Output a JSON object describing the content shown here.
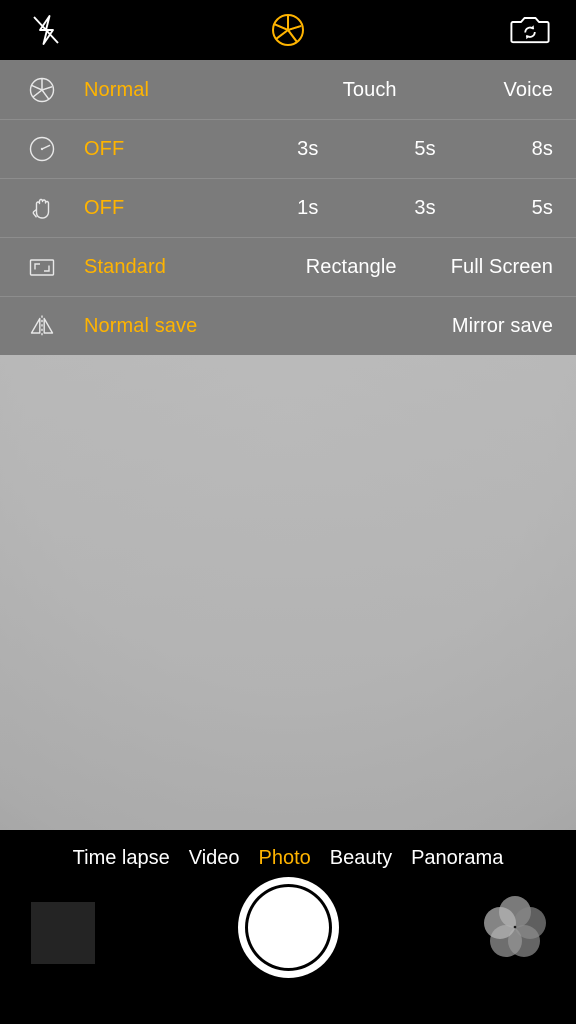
{
  "top_bar": {
    "flash_icon": "flash-off-icon",
    "flash_label": "Flash off",
    "shutter_mode_icon": "aperture-icon",
    "shutter_mode_label": "Aperture",
    "switch_camera_icon": "camera-switch-icon",
    "switch_camera_label": "Switch camera"
  },
  "settings": {
    "rows": [
      {
        "icon": "aperture-icon",
        "icon_label": "Capture mode",
        "options": [
          {
            "label": "Normal",
            "selected": true
          },
          {
            "label": "Touch",
            "selected": false
          },
          {
            "label": "Voice",
            "selected": false
          }
        ]
      },
      {
        "icon": "timer-icon",
        "icon_label": "Timer",
        "options": [
          {
            "label": "OFF",
            "selected": true
          },
          {
            "label": "3s",
            "selected": false
          },
          {
            "label": "5s",
            "selected": false
          },
          {
            "label": "8s",
            "selected": false
          }
        ]
      },
      {
        "icon": "hand-gesture-icon",
        "icon_label": "Gesture shot",
        "options": [
          {
            "label": "OFF",
            "selected": true
          },
          {
            "label": "1s",
            "selected": false
          },
          {
            "label": "3s",
            "selected": false
          },
          {
            "label": "5s",
            "selected": false
          }
        ]
      },
      {
        "icon": "frame-ratio-icon",
        "icon_label": "Aspect ratio",
        "options": [
          {
            "label": "Standard",
            "selected": true
          },
          {
            "label": "Rectangle",
            "selected": false
          },
          {
            "label": "Full Screen",
            "selected": false
          }
        ]
      },
      {
        "icon": "mirror-icon",
        "icon_label": "Mirror save",
        "options": [
          {
            "label": "Normal save",
            "selected": true
          },
          {
            "label": "Mirror save",
            "selected": false
          }
        ]
      }
    ]
  },
  "modes": [
    {
      "label": "Time lapse",
      "active": false
    },
    {
      "label": "Video",
      "active": false
    },
    {
      "label": "Photo",
      "active": true
    },
    {
      "label": "Beauty",
      "active": false
    },
    {
      "label": "Panorama",
      "active": false
    }
  ],
  "controls": {
    "thumbnail_label": "Gallery thumbnail",
    "shutter_label": "Shutter",
    "filter_icon": "filter-flower-icon",
    "filter_label": "Filters"
  },
  "colors": {
    "accent": "#ffb400",
    "panel_bg": "#7b7b7b",
    "divider": "#8d8d8d",
    "bar_bg": "#000000",
    "text": "#ffffff",
    "thumbnail": "#242424"
  }
}
